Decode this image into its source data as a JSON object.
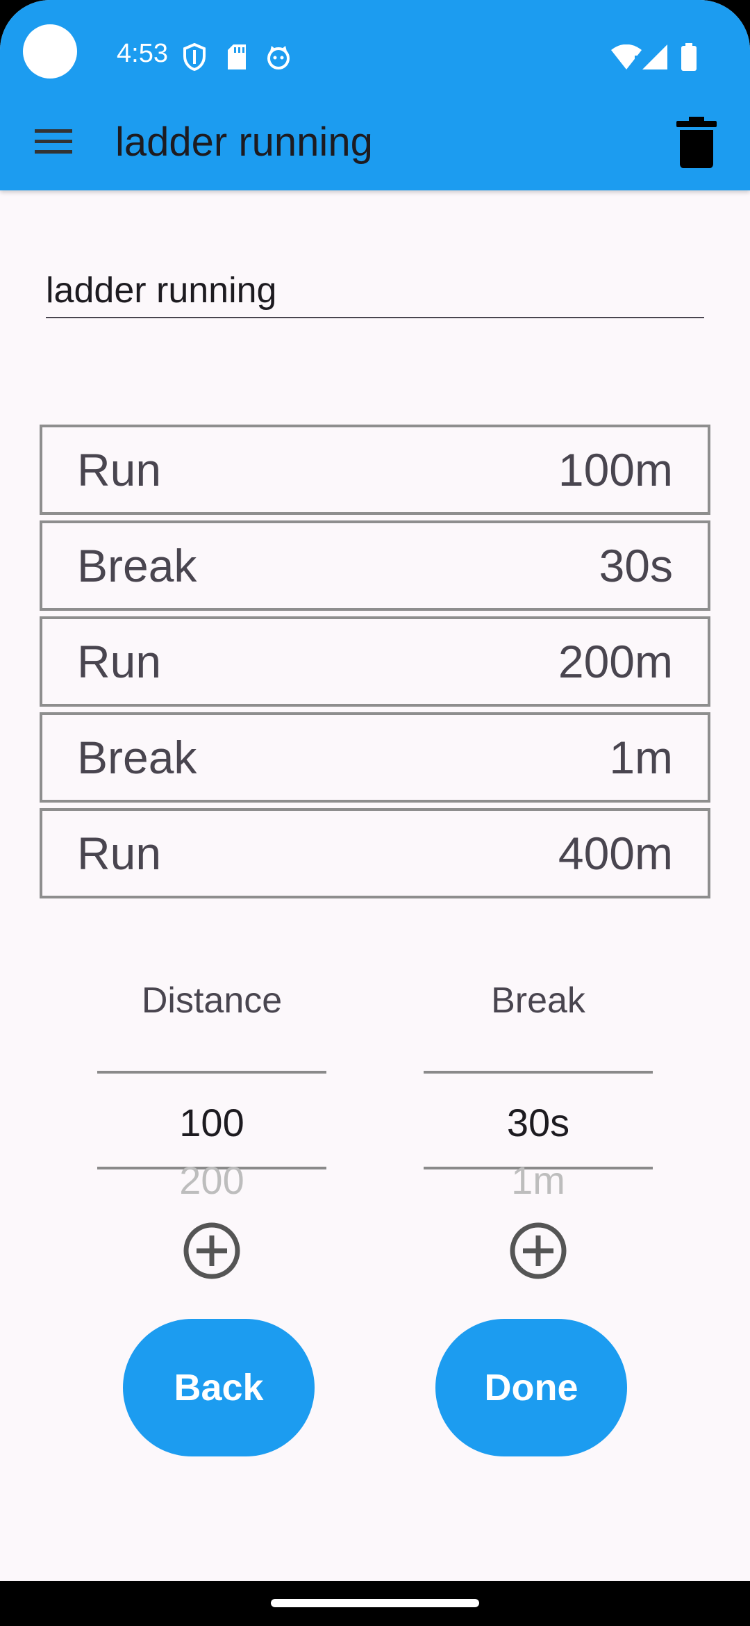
{
  "status_bar": {
    "time": "4:53"
  },
  "app_bar": {
    "title": "ladder running",
    "menu_icon": "hamburger-menu-icon",
    "delete_icon": "trash-icon"
  },
  "workout_name": {
    "value": "ladder running"
  },
  "steps": [
    {
      "type": "Run",
      "value": "100m"
    },
    {
      "type": "Break",
      "value": "30s"
    },
    {
      "type": "Run",
      "value": "200m"
    },
    {
      "type": "Break",
      "value": "1m"
    },
    {
      "type": "Run",
      "value": "400m"
    }
  ],
  "pickers": {
    "distance": {
      "label": "Distance",
      "selected": "100",
      "next": "200"
    },
    "break": {
      "label": "Break",
      "selected": "30s",
      "next": "1m"
    }
  },
  "buttons": {
    "back_label": "Back",
    "done_label": "Done"
  },
  "colors": {
    "primary": "#1c9cf0",
    "background": "#fcf8fb",
    "row_border": "#8e8e8e",
    "text": "#49454f"
  }
}
